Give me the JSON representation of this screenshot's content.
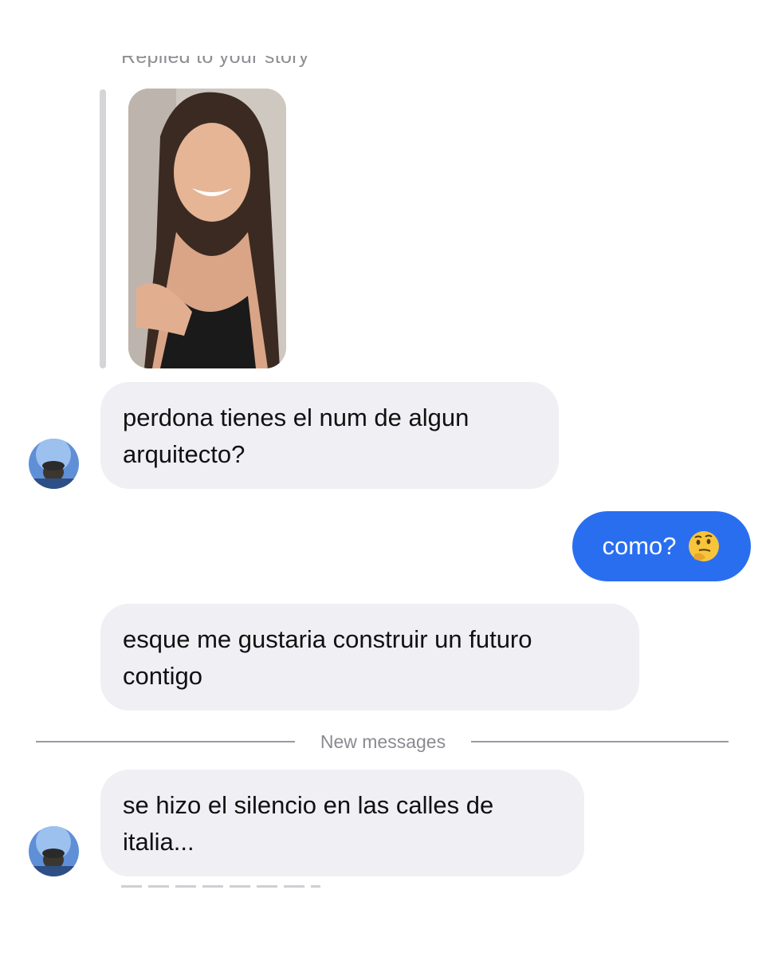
{
  "story_reply": {
    "label": "Replied to your story"
  },
  "messages": {
    "m1": {
      "line1": "perdona tienes el num de algun",
      "line2": "arquitecto?"
    },
    "m2": {
      "text": "como?",
      "emoji_icon": "thinking-face-emoji"
    },
    "m3": {
      "line1": "esque me gustaria construir un futuro",
      "line2": "contigo"
    },
    "m4": {
      "line1": "se hizo el silencio en las calles de",
      "line2": "italia..."
    }
  },
  "divider": {
    "label": "New messages"
  },
  "colors": {
    "incoming_bubble": "#efeff4",
    "outgoing_bubble": "#2a6ef0",
    "secondary_text": "#8e8e93"
  }
}
